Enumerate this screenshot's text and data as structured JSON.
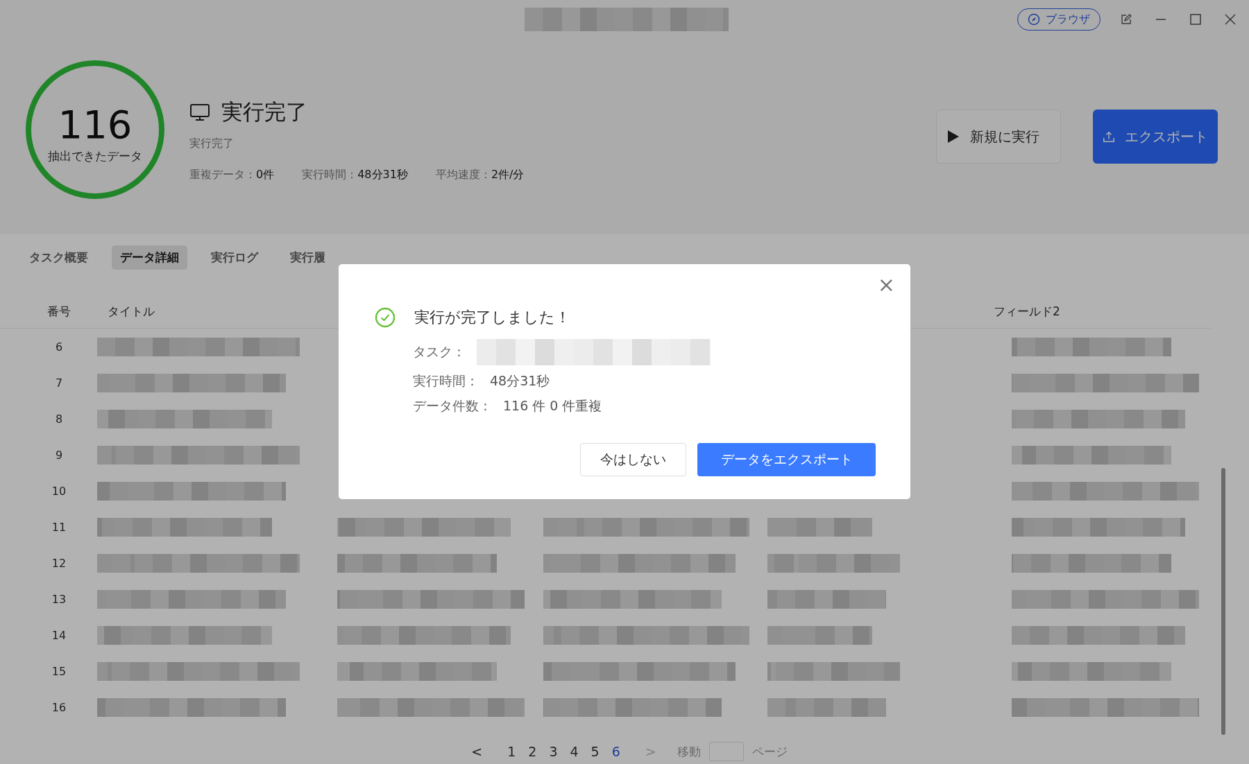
{
  "title_bar": {
    "browser_button": "ブラウザ"
  },
  "summary": {
    "count": "116",
    "count_label": "抽出できたデータ",
    "status": "実行完了",
    "substatus": "実行完了",
    "stats": [
      {
        "label": "重複データ：",
        "value": "0件"
      },
      {
        "label": "実行時間：",
        "value": "48分31秒"
      },
      {
        "label": "平均速度：",
        "value": "2件/分"
      }
    ]
  },
  "actions": [
    {
      "label": "新規に実行",
      "kind": "run"
    },
    {
      "label": "エクスポート",
      "kind": "export"
    }
  ],
  "tabs": [
    {
      "label": "タスク概要",
      "selected": false
    },
    {
      "label": "データ詳細",
      "selected": true
    },
    {
      "label": "実行ログ",
      "selected": false
    },
    {
      "label": "実行履",
      "selected": false
    }
  ],
  "table": {
    "columns": [
      "番号",
      "タイトル",
      "フィールド2"
    ],
    "rows": [
      {
        "number": "6"
      },
      {
        "number": "7"
      },
      {
        "number": "8"
      },
      {
        "number": "9"
      },
      {
        "number": "10"
      },
      {
        "number": "11"
      },
      {
        "number": "12"
      },
      {
        "number": "13"
      },
      {
        "number": "14"
      },
      {
        "number": "15"
      },
      {
        "number": "16"
      }
    ]
  },
  "pagination": {
    "pages": [
      {
        "label": "1",
        "selected": false
      },
      {
        "label": "2",
        "selected": false
      },
      {
        "label": "3",
        "selected": false
      },
      {
        "label": "4",
        "selected": false
      },
      {
        "label": "5",
        "selected": false
      },
      {
        "label": "6",
        "selected": true
      }
    ],
    "prev": "<",
    "next": ">",
    "goto_label": "移動",
    "goto_suffix": "ページ"
  },
  "dialog": {
    "title": "実行が完了しました！",
    "close": "×",
    "fields": [
      {
        "label": "タスク：",
        "kind": "redacted"
      },
      {
        "label": "実行時間：",
        "value": "48分31秒"
      },
      {
        "label": "データ件数：",
        "value": "116 件 0 件重複"
      }
    ],
    "buttons": [
      {
        "label": "今はしない",
        "kind": "secondary"
      },
      {
        "label": "データをエクスポート",
        "kind": "primary"
      }
    ]
  }
}
